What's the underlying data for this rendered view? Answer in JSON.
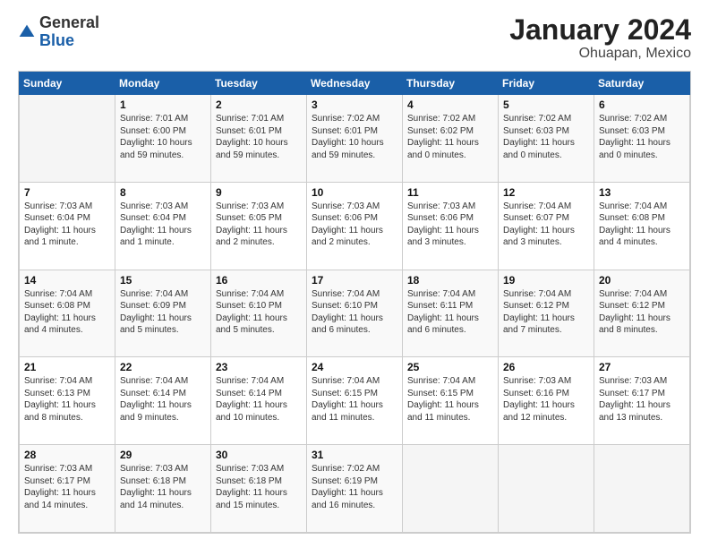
{
  "logo": {
    "general": "General",
    "blue": "Blue"
  },
  "header": {
    "title": "January 2024",
    "subtitle": "Ohuapan, Mexico"
  },
  "weekdays": [
    "Sunday",
    "Monday",
    "Tuesday",
    "Wednesday",
    "Thursday",
    "Friday",
    "Saturday"
  ],
  "weeks": [
    [
      {
        "day": "",
        "info": ""
      },
      {
        "day": "1",
        "info": "Sunrise: 7:01 AM\nSunset: 6:00 PM\nDaylight: 10 hours\nand 59 minutes."
      },
      {
        "day": "2",
        "info": "Sunrise: 7:01 AM\nSunset: 6:01 PM\nDaylight: 10 hours\nand 59 minutes."
      },
      {
        "day": "3",
        "info": "Sunrise: 7:02 AM\nSunset: 6:01 PM\nDaylight: 10 hours\nand 59 minutes."
      },
      {
        "day": "4",
        "info": "Sunrise: 7:02 AM\nSunset: 6:02 PM\nDaylight: 11 hours\nand 0 minutes."
      },
      {
        "day": "5",
        "info": "Sunrise: 7:02 AM\nSunset: 6:03 PM\nDaylight: 11 hours\nand 0 minutes."
      },
      {
        "day": "6",
        "info": "Sunrise: 7:02 AM\nSunset: 6:03 PM\nDaylight: 11 hours\nand 0 minutes."
      }
    ],
    [
      {
        "day": "7",
        "info": "Sunrise: 7:03 AM\nSunset: 6:04 PM\nDaylight: 11 hours\nand 1 minute."
      },
      {
        "day": "8",
        "info": "Sunrise: 7:03 AM\nSunset: 6:04 PM\nDaylight: 11 hours\nand 1 minute."
      },
      {
        "day": "9",
        "info": "Sunrise: 7:03 AM\nSunset: 6:05 PM\nDaylight: 11 hours\nand 2 minutes."
      },
      {
        "day": "10",
        "info": "Sunrise: 7:03 AM\nSunset: 6:06 PM\nDaylight: 11 hours\nand 2 minutes."
      },
      {
        "day": "11",
        "info": "Sunrise: 7:03 AM\nSunset: 6:06 PM\nDaylight: 11 hours\nand 3 minutes."
      },
      {
        "day": "12",
        "info": "Sunrise: 7:04 AM\nSunset: 6:07 PM\nDaylight: 11 hours\nand 3 minutes."
      },
      {
        "day": "13",
        "info": "Sunrise: 7:04 AM\nSunset: 6:08 PM\nDaylight: 11 hours\nand 4 minutes."
      }
    ],
    [
      {
        "day": "14",
        "info": "Sunrise: 7:04 AM\nSunset: 6:08 PM\nDaylight: 11 hours\nand 4 minutes."
      },
      {
        "day": "15",
        "info": "Sunrise: 7:04 AM\nSunset: 6:09 PM\nDaylight: 11 hours\nand 5 minutes."
      },
      {
        "day": "16",
        "info": "Sunrise: 7:04 AM\nSunset: 6:10 PM\nDaylight: 11 hours\nand 5 minutes."
      },
      {
        "day": "17",
        "info": "Sunrise: 7:04 AM\nSunset: 6:10 PM\nDaylight: 11 hours\nand 6 minutes."
      },
      {
        "day": "18",
        "info": "Sunrise: 7:04 AM\nSunset: 6:11 PM\nDaylight: 11 hours\nand 6 minutes."
      },
      {
        "day": "19",
        "info": "Sunrise: 7:04 AM\nSunset: 6:12 PM\nDaylight: 11 hours\nand 7 minutes."
      },
      {
        "day": "20",
        "info": "Sunrise: 7:04 AM\nSunset: 6:12 PM\nDaylight: 11 hours\nand 8 minutes."
      }
    ],
    [
      {
        "day": "21",
        "info": "Sunrise: 7:04 AM\nSunset: 6:13 PM\nDaylight: 11 hours\nand 8 minutes."
      },
      {
        "day": "22",
        "info": "Sunrise: 7:04 AM\nSunset: 6:14 PM\nDaylight: 11 hours\nand 9 minutes."
      },
      {
        "day": "23",
        "info": "Sunrise: 7:04 AM\nSunset: 6:14 PM\nDaylight: 11 hours\nand 10 minutes."
      },
      {
        "day": "24",
        "info": "Sunrise: 7:04 AM\nSunset: 6:15 PM\nDaylight: 11 hours\nand 11 minutes."
      },
      {
        "day": "25",
        "info": "Sunrise: 7:04 AM\nSunset: 6:15 PM\nDaylight: 11 hours\nand 11 minutes."
      },
      {
        "day": "26",
        "info": "Sunrise: 7:03 AM\nSunset: 6:16 PM\nDaylight: 11 hours\nand 12 minutes."
      },
      {
        "day": "27",
        "info": "Sunrise: 7:03 AM\nSunset: 6:17 PM\nDaylight: 11 hours\nand 13 minutes."
      }
    ],
    [
      {
        "day": "28",
        "info": "Sunrise: 7:03 AM\nSunset: 6:17 PM\nDaylight: 11 hours\nand 14 minutes."
      },
      {
        "day": "29",
        "info": "Sunrise: 7:03 AM\nSunset: 6:18 PM\nDaylight: 11 hours\nand 14 minutes."
      },
      {
        "day": "30",
        "info": "Sunrise: 7:03 AM\nSunset: 6:18 PM\nDaylight: 11 hours\nand 15 minutes."
      },
      {
        "day": "31",
        "info": "Sunrise: 7:02 AM\nSunset: 6:19 PM\nDaylight: 11 hours\nand 16 minutes."
      },
      {
        "day": "",
        "info": ""
      },
      {
        "day": "",
        "info": ""
      },
      {
        "day": "",
        "info": ""
      }
    ]
  ]
}
